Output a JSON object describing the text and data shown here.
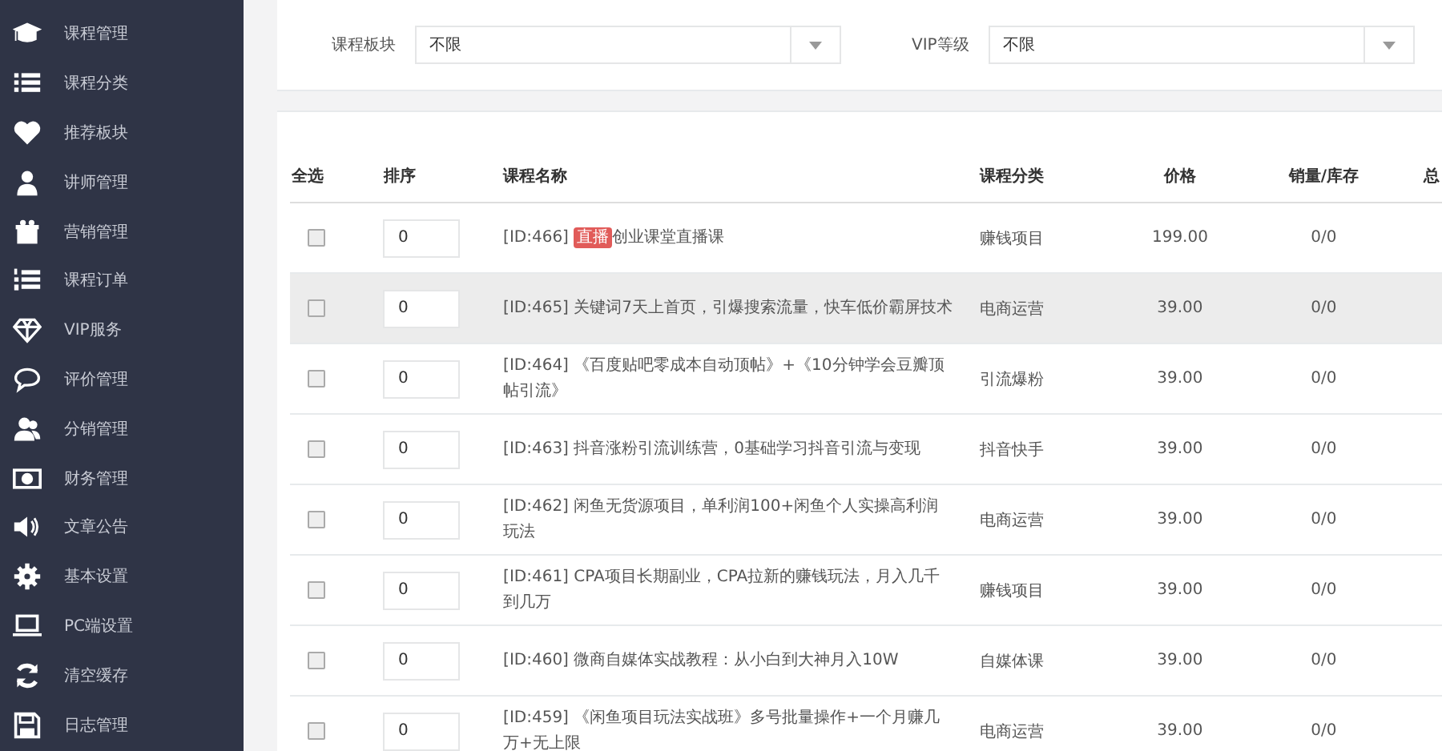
{
  "sidebar": {
    "items": [
      {
        "label": "课程管理"
      },
      {
        "label": "课程分类"
      },
      {
        "label": "推荐板块"
      },
      {
        "label": "讲师管理"
      },
      {
        "label": "营销管理"
      },
      {
        "label": "课程订单"
      },
      {
        "label": "VIP服务"
      },
      {
        "label": "评价管理"
      },
      {
        "label": "分销管理"
      },
      {
        "label": "财务管理"
      },
      {
        "label": "文章公告"
      },
      {
        "label": "基本设置"
      },
      {
        "label": "PC端设置"
      },
      {
        "label": "清空缓存"
      },
      {
        "label": "日志管理"
      }
    ]
  },
  "filters": [
    {
      "label": "课程板块",
      "value": "不限"
    },
    {
      "label": "VIP等级",
      "value": "不限"
    }
  ],
  "table": {
    "columns": [
      "全选",
      "排序",
      "课程名称",
      "课程分类",
      "价格",
      "销量/库存",
      "总"
    ],
    "rows": [
      {
        "checked": false,
        "highlighted": false,
        "sort": "0",
        "id": "[ID:466]",
        "badge": "直播",
        "name": "创业课堂直播课",
        "category": "赚钱项目",
        "price": "199.00",
        "stock": "0/0"
      },
      {
        "checked": false,
        "highlighted": true,
        "sort": "0",
        "id": "[ID:465]",
        "name": "关键词7天上首页，引爆搜索流量，快车低价霸屏技术",
        "category": "电商运营",
        "price": "39.00",
        "stock": "0/0"
      },
      {
        "checked": false,
        "highlighted": false,
        "sort": "0",
        "id": "[ID:464]",
        "name": "《百度贴吧零成本自动顶帖》+《10分钟学会豆瓣顶帖引流》",
        "category": "引流爆粉",
        "price": "39.00",
        "stock": "0/0"
      },
      {
        "checked": false,
        "highlighted": false,
        "sort": "0",
        "id": "[ID:463]",
        "name": "抖音涨粉引流训练营，0基础学习抖音引流与变现",
        "category": "抖音快手",
        "price": "39.00",
        "stock": "0/0"
      },
      {
        "checked": false,
        "highlighted": false,
        "sort": "0",
        "id": "[ID:462]",
        "name": "闲鱼无货源项目，单利润100+闲鱼个人实操高利润玩法",
        "category": "电商运营",
        "price": "39.00",
        "stock": "0/0"
      },
      {
        "checked": false,
        "highlighted": false,
        "sort": "0",
        "id": "[ID:461]",
        "name": "CPA项目长期副业，CPA拉新的赚钱玩法，月入几千到几万",
        "category": "赚钱项目",
        "price": "39.00",
        "stock": "0/0"
      },
      {
        "checked": false,
        "highlighted": false,
        "sort": "0",
        "id": "[ID:460]",
        "name": "微商自媒体实战教程：从小白到大神月入10W",
        "category": "自媒体课",
        "price": "39.00",
        "stock": "0/0"
      },
      {
        "checked": false,
        "highlighted": false,
        "sort": "0",
        "id": "[ID:459]",
        "name": "《闲鱼项目玩法实战班》多号批量操作+一个月赚几万+无上限",
        "category": "电商运营",
        "price": "39.00",
        "stock": "0/0"
      }
    ]
  }
}
